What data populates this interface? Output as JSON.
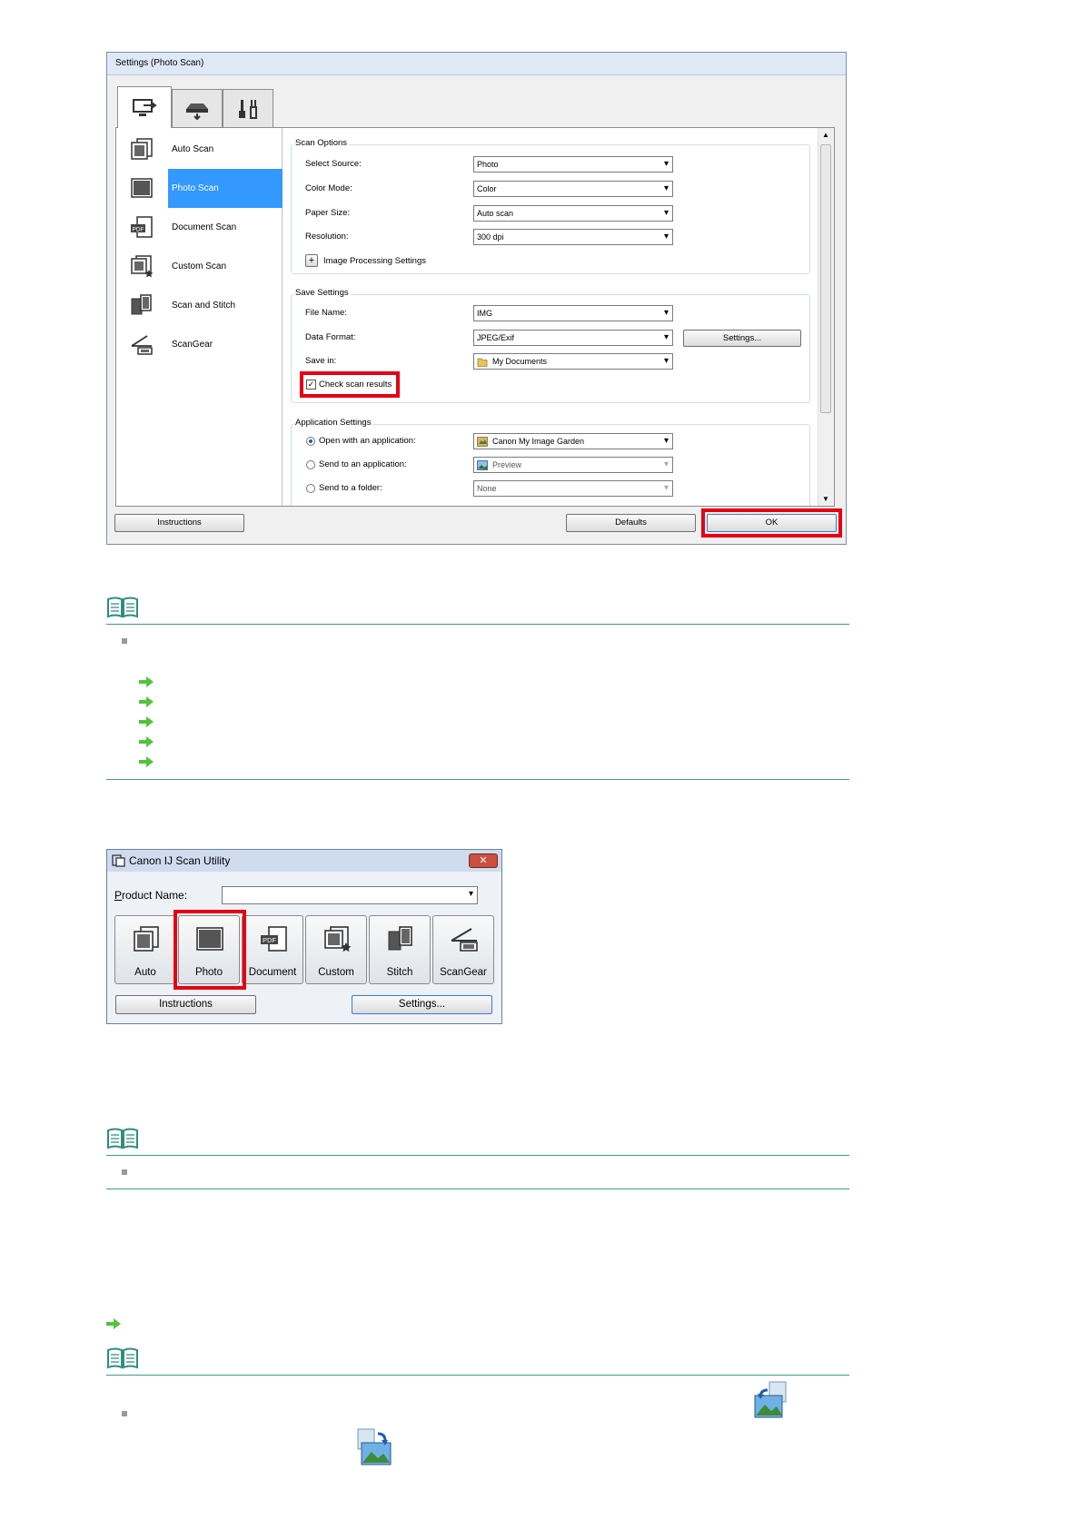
{
  "settings_dialog": {
    "title": "Settings (Photo Scan)",
    "tabs": [
      {
        "icon": "scan-from-computer-icon"
      },
      {
        "icon": "scan-from-operation-panel-icon"
      },
      {
        "icon": "general-settings-icon"
      }
    ],
    "left_items": [
      {
        "label": "Auto Scan",
        "icon": "auto-scan-icon"
      },
      {
        "label": "Photo Scan",
        "icon": "photo-scan-icon"
      },
      {
        "label": "Document Scan",
        "icon": "document-scan-icon"
      },
      {
        "label": "Custom Scan",
        "icon": "custom-scan-icon"
      },
      {
        "label": "Scan and Stitch",
        "icon": "scan-and-stitch-icon"
      },
      {
        "label": "ScanGear",
        "icon": "scangear-icon"
      }
    ],
    "scan_options": {
      "title": "Scan Options",
      "rows": [
        {
          "label": "Select Source:",
          "value": "Photo"
        },
        {
          "label": "Color Mode:",
          "value": "Color"
        },
        {
          "label": "Paper Size:",
          "value": "Auto scan"
        },
        {
          "label": "Resolution:",
          "value": "300 dpi"
        }
      ],
      "expand": "Image Processing Settings"
    },
    "save_settings": {
      "title": "Save Settings",
      "file_name_label": "File Name:",
      "file_name_value": "IMG",
      "data_format_label": "Data Format:",
      "data_format_value": "JPEG/Exif",
      "settings_button": "Settings...",
      "save_in_label": "Save in:",
      "save_in_value": "My Documents",
      "check_label": "Check scan results"
    },
    "application_settings": {
      "title": "Application Settings",
      "rows": [
        {
          "label": "Open with an application:",
          "value": "Canon My Image Garden"
        },
        {
          "label": "Send to an application:",
          "value": "Preview"
        },
        {
          "label": "Send to a folder:",
          "value": "None"
        }
      ]
    },
    "buttons": {
      "instructions": "Instructions",
      "defaults": "Defaults",
      "ok": "OK"
    }
  },
  "ij_utility": {
    "title": "Canon IJ Scan Utility",
    "close": "✕",
    "product_name_label": "Product Name:",
    "product_name_value": "",
    "buttons": [
      {
        "label": "Auto",
        "icon": "auto-scan-icon"
      },
      {
        "label": "Photo",
        "icon": "photo-scan-icon"
      },
      {
        "label": "Document",
        "icon": "document-scan-icon"
      },
      {
        "label": "Custom",
        "icon": "custom-scan-icon"
      },
      {
        "label": "Stitch",
        "icon": "scan-and-stitch-icon"
      },
      {
        "label": "ScanGear",
        "icon": "scangear-icon"
      }
    ],
    "instructions": "Instructions",
    "settings": "Settings..."
  },
  "colors": {
    "highlight_red": "#e60012",
    "note_rule": "#3c9d8d",
    "arrow_green": "#55c33a",
    "selection_blue": "#3399ff"
  }
}
